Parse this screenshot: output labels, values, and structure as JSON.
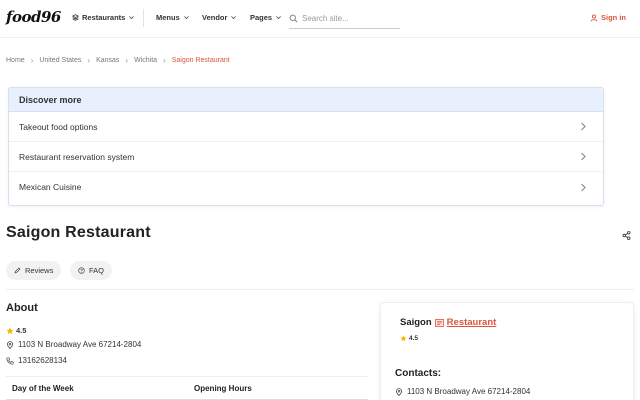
{
  "header": {
    "logo": "food96",
    "nav": [
      {
        "label": "Restaurants"
      },
      {
        "label": "Menus"
      },
      {
        "label": "Vendor"
      },
      {
        "label": "Pages"
      }
    ],
    "search_placeholder": "Search site...",
    "sign_in": "Sign in"
  },
  "breadcrumb": [
    "Home",
    "United States",
    "Kansas",
    "Wichita",
    "Saigon Restaurant"
  ],
  "discover": {
    "title": "Discover more",
    "items": [
      "Takeout food options",
      "Restaurant reservation system",
      "Mexican Cuisine"
    ]
  },
  "page_title": "Saigon Restaurant",
  "tabs": [
    "Reviews",
    "FAQ"
  ],
  "about": {
    "heading": "About",
    "rating": "4.5",
    "address": "1103 N Broadway Ave 67214-2804",
    "phone": "13162628134",
    "table_headers": [
      "Day of the Week",
      "Opening Hours"
    ]
  },
  "card": {
    "name": "Saigon",
    "type": "Restaurant",
    "rating": "4.5",
    "contacts_heading": "Contacts:",
    "address": "1103 N Broadway Ave 67214-2804"
  },
  "colors": {
    "accent": "#d9553b",
    "star": "#f4b400",
    "discover_bg": "#e8f0fe"
  }
}
